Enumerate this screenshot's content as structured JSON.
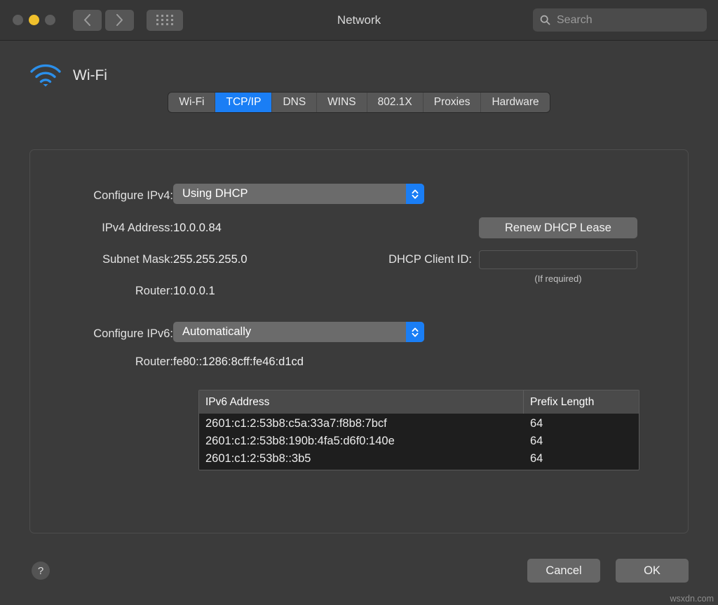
{
  "window": {
    "title": "Network",
    "traffic_lights": [
      "close-disabled",
      "minimize-yellow",
      "zoom-disabled"
    ],
    "back_icon": "chevron-left-icon",
    "forward_icon": "chevron-right-icon",
    "grid_icon": "show-all-grid-icon"
  },
  "search": {
    "placeholder": "Search",
    "value": "",
    "icon": "search-icon"
  },
  "service": {
    "name": "Wi-Fi",
    "icon": "wifi-icon",
    "icon_color": "#2b8fea"
  },
  "tabs": [
    {
      "label": "Wi-Fi",
      "active": false
    },
    {
      "label": "TCP/IP",
      "active": true
    },
    {
      "label": "DNS",
      "active": false
    },
    {
      "label": "WINS",
      "active": false
    },
    {
      "label": "802.1X",
      "active": false
    },
    {
      "label": "Proxies",
      "active": false
    },
    {
      "label": "Hardware",
      "active": false
    }
  ],
  "accent_color": "#1a7ef5",
  "ipv4": {
    "configure_label": "Configure IPv4:",
    "configure_value": "Using DHCP",
    "address_label": "IPv4 Address:",
    "address_value": "10.0.0.84",
    "subnet_label": "Subnet Mask:",
    "subnet_value": "255.255.255.0",
    "router_label": "Router:",
    "router_value": "10.0.0.1",
    "renew_button": "Renew DHCP Lease",
    "client_id_label": "DHCP Client ID:",
    "client_id_value": "",
    "client_id_hint": "(If required)"
  },
  "ipv6": {
    "configure_label": "Configure IPv6:",
    "configure_value": "Automatically",
    "router_label": "Router:",
    "router_value": "fe80::1286:8cff:fe46:d1cd",
    "table": {
      "columns": [
        "IPv6 Address",
        "Prefix Length"
      ],
      "rows": [
        {
          "address": "2601:c1:2:53b8:c5a:33a7:f8b8:7bcf",
          "prefix": "64"
        },
        {
          "address": "2601:c1:2:53b8:190b:4fa5:d6f0:140e",
          "prefix": "64"
        },
        {
          "address": "2601:c1:2:53b8::3b5",
          "prefix": "64"
        }
      ]
    }
  },
  "footer": {
    "help_label": "?",
    "cancel_label": "Cancel",
    "ok_label": "OK"
  },
  "watermark": "wsxdn.com"
}
